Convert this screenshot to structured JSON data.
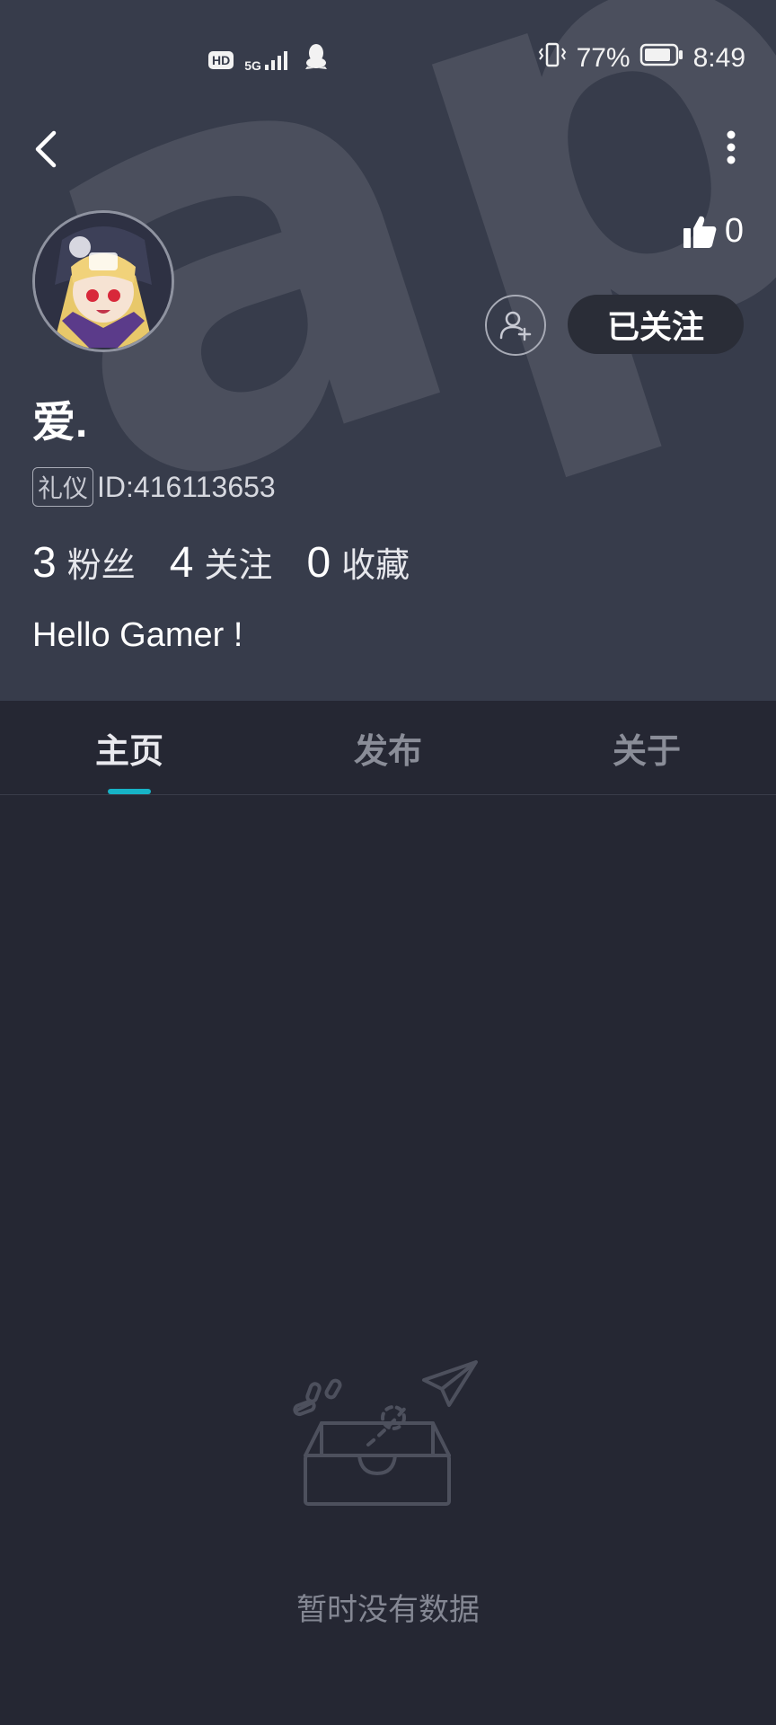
{
  "statusbar": {
    "hd_label": "HD",
    "network_label": "5G",
    "battery_percent": "77%",
    "time": "8:49"
  },
  "header": {
    "watermark_text": "apTa",
    "likes_count": "0",
    "follow_button_label": "已关注"
  },
  "profile": {
    "username": "爱.",
    "tag_label": "礼仪",
    "id_text": "ID:416113653",
    "stats": [
      {
        "value": "3",
        "label": "粉丝"
      },
      {
        "value": "4",
        "label": "关注"
      },
      {
        "value": "0",
        "label": "收藏"
      }
    ],
    "bio": "Hello Gamer !"
  },
  "tabs": [
    {
      "label": "主页",
      "active": true
    },
    {
      "label": "发布",
      "active": false
    },
    {
      "label": "关于",
      "active": false
    }
  ],
  "empty_state": {
    "message": "暂时没有数据"
  },
  "colors": {
    "header_bg": "#373c4b",
    "page_bg": "#252733",
    "accent": "#17b3c7"
  },
  "icons": [
    "back-icon",
    "more-vertical-icon",
    "thumbs-up-icon",
    "add-user-icon",
    "empty-box-icon",
    "paper-plane-icon",
    "vibrate-icon",
    "battery-icon",
    "signal-icon",
    "qq-icon"
  ]
}
